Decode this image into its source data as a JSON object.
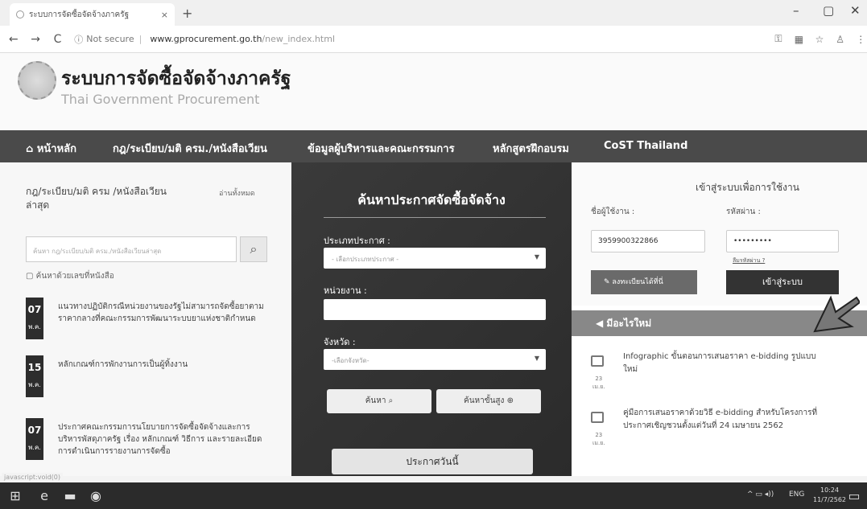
{
  "browser": {
    "tab_title": "ระบบการจัดซื้อจัดจ้างภาครัฐ",
    "tab_close": "×",
    "new_tab": "+",
    "security": "Not secure",
    "url_host": "www.gprocurement.go.th",
    "url_path": "/new_index.html",
    "window_controls": [
      "–",
      "▢",
      "✕"
    ]
  },
  "site": {
    "title_th": "ระบบการจัดซื้อจัดจ้างภาครัฐ",
    "title_en": "Thai Government Procurement"
  },
  "nav": {
    "home": "หน้าหลัก",
    "laws": "กฎ/ระเบียบ/มติ ครม./หนังสือเวียน",
    "executives": "ข้อมูลผู้บริหารและคณะกรรมการ",
    "training": "หลักสูตรฝึกอบรม",
    "cost": "CoST Thailand"
  },
  "left": {
    "title": "กฎ/ระเบียบ/มติ ครม /หนังสือเวียน ล่าสุด",
    "read_all": "อ่านทั้งหมด",
    "search_placeholder": "ค้นหา กฎ/ระเบียบ/มติ ครม./หนังสือเวียนล่าสุด",
    "search_by_number": "ค้นหาด้วยเลขที่หนังสือ",
    "news": [
      {
        "day": "07",
        "month": "พ.ค.",
        "text": "แนวทางปฏิบัติกรณีหน่วยงานของรัฐไม่สามารถจัดซื้อยาตามราคากลางที่คณะกรรมการพัฒนาระบบยาแห่งชาติกำหนด"
      },
      {
        "day": "15",
        "month": "พ.ค.",
        "text": "หลักเกณฑ์การพักงานการเป็นผู้ทิ้งงาน"
      },
      {
        "day": "07",
        "month": "พ.ค.",
        "text": "ประกาศคณะกรรมการนโยบายการจัดซื้อจัดจ้างและการบริหารพัสดุภาครัฐ เรื่อง หลักเกณฑ์ วิธีการ และรายละเอียดการดำเนินการรายงานการจัดซื้อ"
      }
    ]
  },
  "center": {
    "title": "ค้นหาประกาศจัดซื้อจัดจ้าง",
    "type_label": "ประเภทประกาศ :",
    "type_value": "- เลือกประเภทประกาศ -",
    "agency_label": "หน่วยงาน :",
    "province_label": "จังหวัด :",
    "province_value": "-เลือกจังหวัด-",
    "search_btn": "ค้นหา",
    "advanced_btn": "ค้นหาขั้นสูง",
    "today_btn": "ประกาศวันนี้"
  },
  "right": {
    "login_title": "เข้าสู่ระบบเพื่อการใช้งาน",
    "username_label": "ชื่อผู้ใช้งาน :",
    "username_value": "3959900322866",
    "password_label": "รหัสผ่าน :",
    "password_value": "•••••••••",
    "forgot": "ลืมรหัสผ่าน ?",
    "register": "ลงทะเบียนได้ที่นี่",
    "login_btn": "เข้าสู่ระบบ",
    "whats_new": "มีอะไรใหม่",
    "items": [
      {
        "day": "23",
        "month": "เม.ย.",
        "text": "Infographic ขั้นตอนการเสนอราคา e-bidding รูปแบบใหม่"
      },
      {
        "day": "23",
        "month": "เม.ย.",
        "text": "คู่มือการเสนอราคาด้วยวิธี e-bidding สำหรับโครงการที่ประกาศเชิญชวนตั้งแต่วันที่ 24 เมษายน 2562"
      }
    ]
  },
  "status_url": "javascript:void(0)",
  "taskbar": {
    "lang": "ENG",
    "time": "10:24",
    "date": "11/7/2562"
  }
}
